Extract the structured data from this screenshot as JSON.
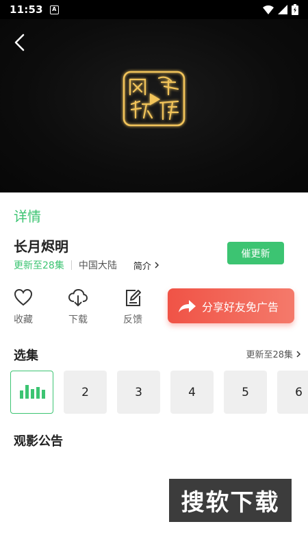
{
  "status_bar": {
    "time": "11:53",
    "app_badge": "A"
  },
  "detail_tab": "详情",
  "show": {
    "title": "长月烬明",
    "update_status": "更新至28集",
    "region": "中国大陆",
    "intro_label": "简介",
    "urge_button": "催更新"
  },
  "actions": {
    "favorite": "收藏",
    "download": "下载",
    "feedback": "反馈",
    "share": "分享好友免广告"
  },
  "episodes": {
    "title": "选集",
    "more_label": "更新至28集",
    "items": [
      "2",
      "3",
      "4",
      "5",
      "6"
    ]
  },
  "notice_title": "观影公告",
  "watermark_text": "搜软下载",
  "colors": {
    "accent": "#3cc472",
    "share_red": "#f05346"
  }
}
